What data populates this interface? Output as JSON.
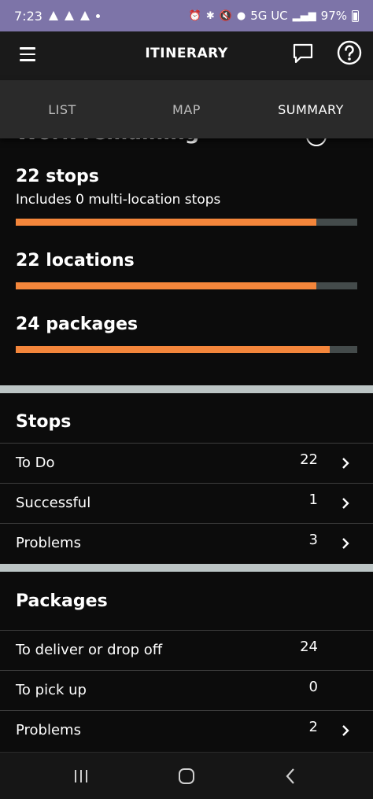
{
  "status_bar": {
    "time": "7:23",
    "network": "5G UC",
    "battery": "97%"
  },
  "header": {
    "title": "ITINERARY"
  },
  "tabs": [
    {
      "label": "LIST",
      "active": false
    },
    {
      "label": "MAP",
      "active": false
    },
    {
      "label": "SUMMARY",
      "active": true
    }
  ],
  "work_remaining": {
    "title": "Work remaining",
    "stops_title": "22 stops",
    "stops_sub": "Includes 0 multi-location stops",
    "stops_progress": 0.88,
    "locations_title": "22 locations",
    "locations_progress": 0.88,
    "packages_title": "24 packages",
    "packages_progress": 0.92
  },
  "stops": {
    "title": "Stops",
    "rows": [
      {
        "label": "To Do",
        "count": "22"
      },
      {
        "label": "Successful",
        "count": "1"
      },
      {
        "label": "Problems",
        "count": "3"
      }
    ]
  },
  "packages": {
    "title": "Packages",
    "rows": [
      {
        "label": "To deliver or drop off",
        "count": "24"
      },
      {
        "label": "To pick up",
        "count": "0"
      },
      {
        "label": "Problems",
        "count": "2"
      }
    ]
  },
  "colors": {
    "accent": "#f4863b",
    "status_bar": "#7d74a8",
    "divider": "#bcc5c5"
  }
}
